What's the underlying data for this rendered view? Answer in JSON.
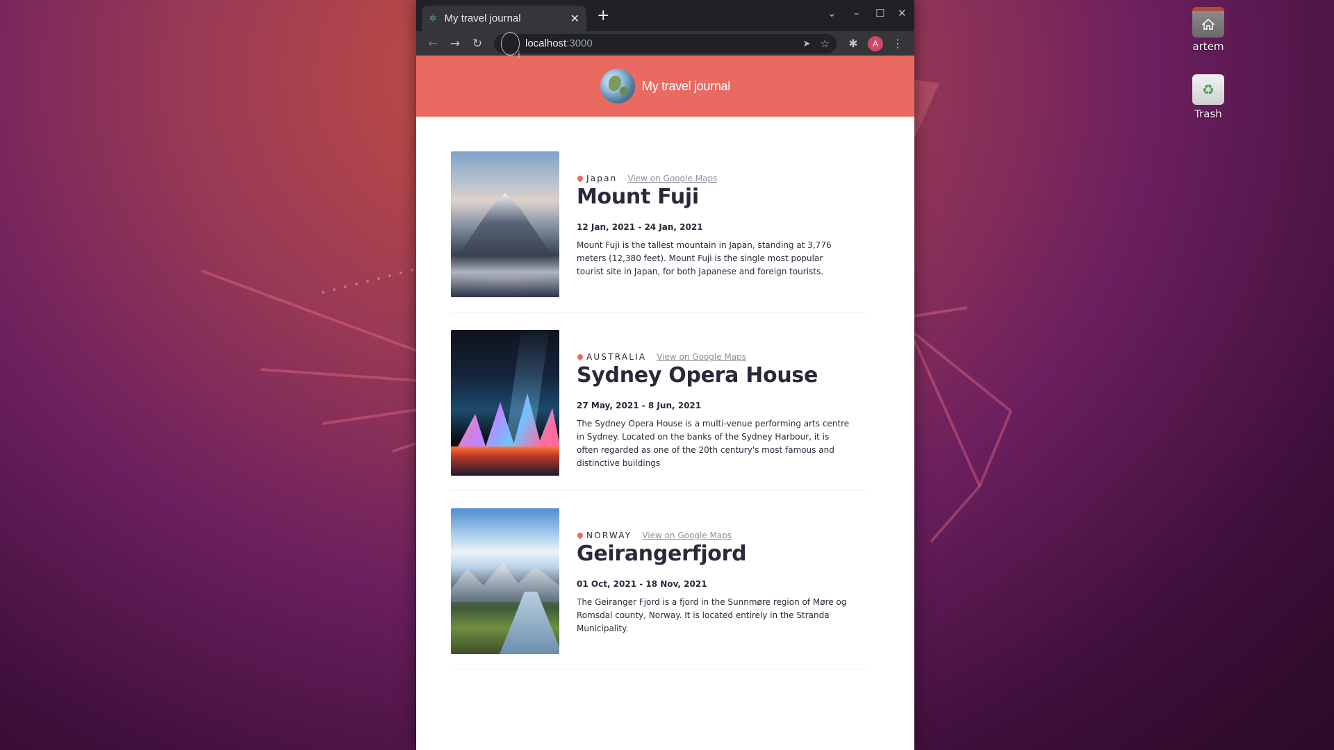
{
  "desktop": {
    "icons": [
      {
        "label": "artem",
        "icon": "home-folder-icon"
      },
      {
        "label": "Trash",
        "icon": "trash-icon"
      }
    ]
  },
  "browser": {
    "tab": {
      "title": "My travel journal",
      "favicon": "react-icon"
    },
    "url": {
      "host": "localhost",
      "port": ":3000"
    },
    "profile_initial": "A"
  },
  "page": {
    "brand": "My travel journal",
    "entries": [
      {
        "country": "JAPAN",
        "country_display": "Japan",
        "map_link": "View on Google Maps",
        "title": "Mount Fuji",
        "dates": "12 Jan, 2021 - 24 Jan, 2021",
        "description": "Mount Fuji is the tallest mountain in Japan, standing at 3,776 meters (12,380 feet). Mount Fuji is the single most popular tourist site in Japan, for both Japanese and foreign tourists."
      },
      {
        "country": "AUSTRALIA",
        "map_link": "View on Google Maps",
        "title": "Sydney Opera House",
        "dates": "27 May, 2021 - 8 Jun, 2021",
        "description": "The Sydney Opera House is a multi-venue performing arts centre in Sydney. Located on the banks of the Sydney Harbour, it is often regarded as one of the 20th century's most famous and distinctive buildings"
      },
      {
        "country": "NORWAY",
        "map_link": "View on Google Maps",
        "title": "Geirangerfjord",
        "dates": "01 Oct, 2021 - 18 Nov, 2021",
        "description": "The Geiranger Fjord is a fjord in the Sunnmøre region of Møre og Romsdal county, Norway. It is located entirely in the Stranda Municipality."
      }
    ]
  },
  "colors": {
    "header_bg": "#e86a61",
    "text_dark": "#2b283a",
    "link_gray": "#918e9b"
  }
}
